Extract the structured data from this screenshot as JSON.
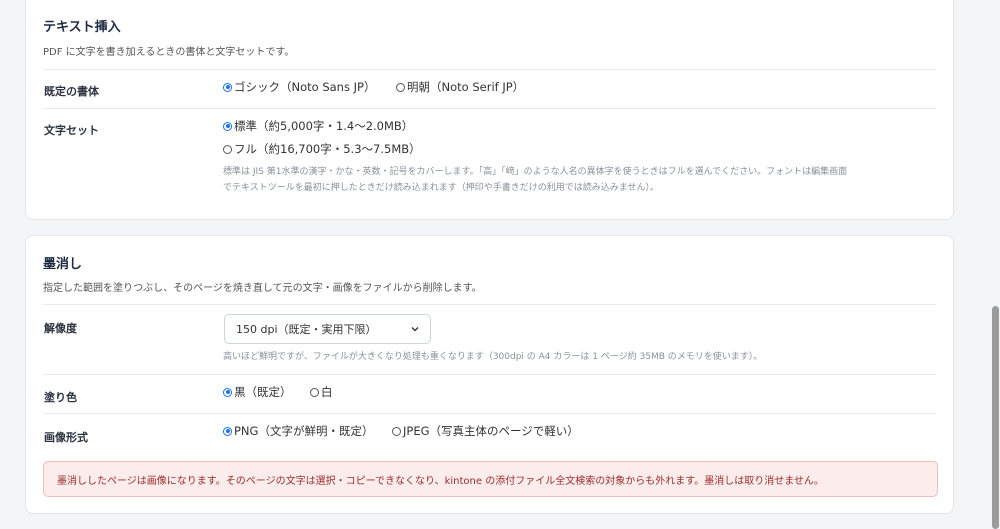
{
  "text_insert": {
    "title": "テキスト挿入",
    "description": "PDF に文字を書き加えるときの書体と文字セットです。",
    "default_font": {
      "label": "既定の書体",
      "options": [
        "ゴシック（Noto Sans JP）",
        "明朝（Noto Serif JP）"
      ],
      "selected": "ゴシック（Noto Sans JP）"
    },
    "charset": {
      "label": "文字セット",
      "options": [
        "標準（約5,000字・1.4〜2.0MB）",
        "フル（約16,700字・5.3〜7.5MB）"
      ],
      "selected": "標準（約5,000字・1.4〜2.0MB）",
      "note_line1": "標準は JIS 第1水準の漢字・かな・英数・記号をカバーします。「高」「﨑」のような人名の異体字を使うときはフルを選んでください。フォントは編集画面",
      "note_line2": "でテキストツールを最初に押したときだけ読み込まれます（押印や手書きだけの利用では読み込みません）。"
    }
  },
  "redaction": {
    "title": "墨消し",
    "description": "指定した範囲を塗りつぶし、そのページを焼き直して元の文字・画像をファイルから削除します。",
    "resolution": {
      "label": "解像度",
      "selected": "150 dpi（既定・実用下限）",
      "note": "高いほど鮮明ですが、ファイルが大きくなり処理も重くなります（300dpi の A4 カラーは 1 ページ約 35MB のメモリを使います）。"
    },
    "fill_color": {
      "label": "塗り色",
      "options": [
        "黒（既定）",
        "白"
      ],
      "selected": "黒（既定）"
    },
    "image_format": {
      "label": "画像形式",
      "options": [
        "PNG（文字が鮮明・既定）",
        "JPEG（写真主体のページで軽い）"
      ],
      "selected": "PNG（文字が鮮明・既定）"
    },
    "warning": "墨消ししたページは画像になります。そのページの文字は選択・コピーできなくなり、kintone の添付ファイル全文検索の対象からも外れます。墨消しは取り消せません。"
  },
  "colors": {
    "accent": "#1a73e8",
    "warning_bg": "#fcecec",
    "warning_text": "#9b2c2c"
  }
}
